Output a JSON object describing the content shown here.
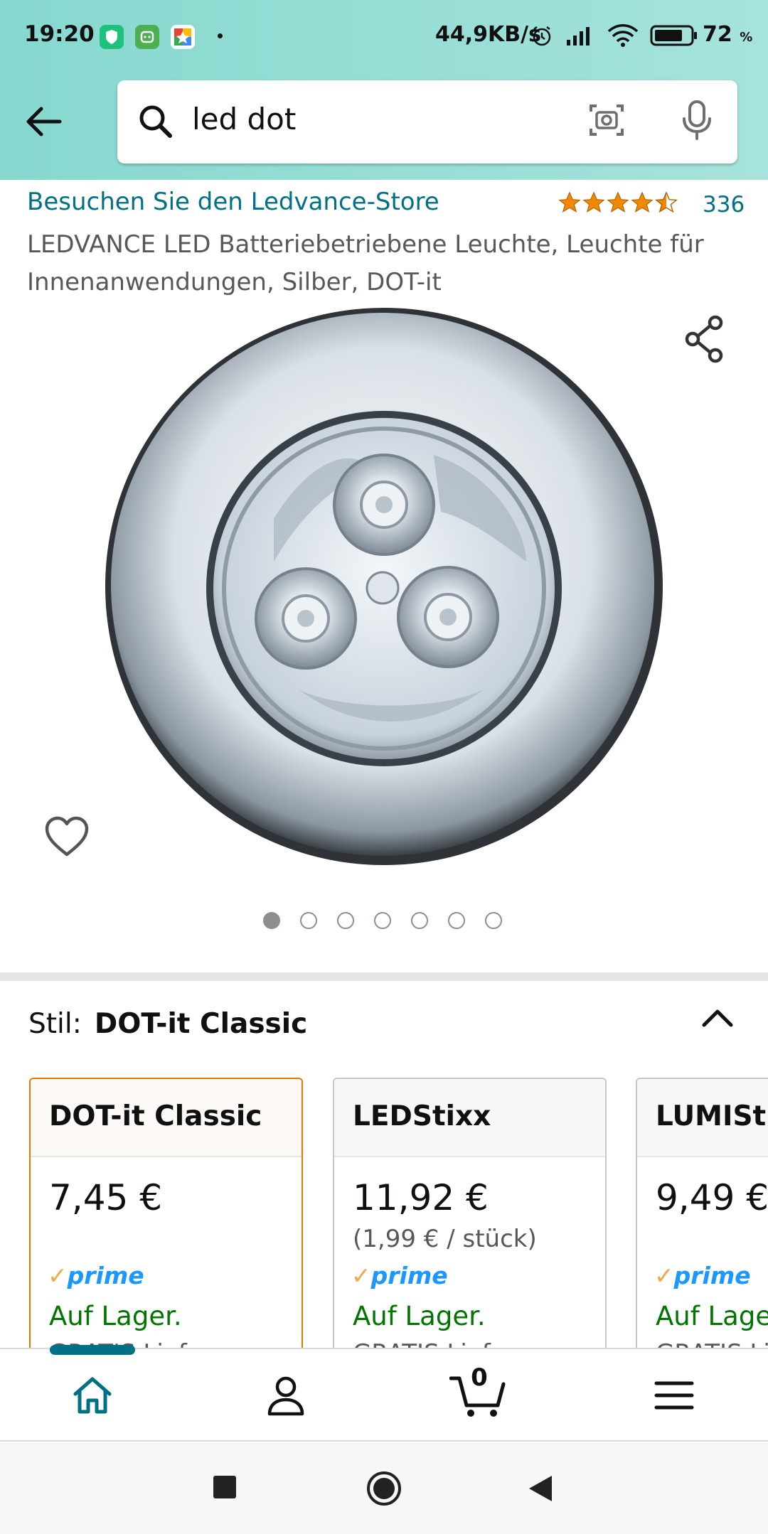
{
  "status_bar": {
    "time": "19:20",
    "network_speed": "44,9KB/s",
    "battery": "72",
    "battery_unit": "%",
    "icons": [
      "shield-app-icon",
      "android-app-icon",
      "photos-app-icon",
      "alarm-icon",
      "signal-icon",
      "wifi-icon",
      "battery-icon"
    ]
  },
  "search": {
    "query": "led dot",
    "icons": [
      "back-arrow-icon",
      "search-icon",
      "camera-scan-icon",
      "microphone-icon"
    ]
  },
  "product": {
    "store_link": "Besuchen Sie den Ledvance-Store",
    "rating_stars": 4.5,
    "rating_count": "336",
    "title": "LEDVANCE LED Batteriebetriebene Leuchte, Leuchte für Innenanwendungen, Silber, DOT-it",
    "image_count": 7,
    "active_image_index": 0
  },
  "style_selector": {
    "label": "Stil:",
    "value": "DOT-it Classic",
    "options": [
      {
        "name": "DOT-it Classic",
        "price": "7,45 €",
        "unit_price": "",
        "prime": "prime",
        "stock": "Auf Lager.",
        "shipping": "GRATIS Lief",
        "selected": true
      },
      {
        "name": "LEDStixx",
        "price": "11,92 €",
        "unit_price": "(1,99 € / stück)",
        "prime": "prime",
        "stock": "Auf Lager.",
        "shipping": "GRATIS Lief",
        "selected": false
      },
      {
        "name": "LUMIStixx",
        "price": "9,49 €",
        "unit_price": "",
        "prime": "prime",
        "stock": "Auf Lager.",
        "shipping": "GRATIS Lief",
        "selected": false
      }
    ]
  },
  "bottom_nav": {
    "cart_count": "0",
    "items": [
      "home-icon",
      "account-icon",
      "cart-icon",
      "menu-icon"
    ]
  },
  "colors": {
    "header_bg": "#9ee0d8",
    "link": "#007185",
    "star": "#f08804",
    "stock_green": "#007600",
    "prime_blue": "#1a98ff",
    "selected_border": "#e77600"
  }
}
